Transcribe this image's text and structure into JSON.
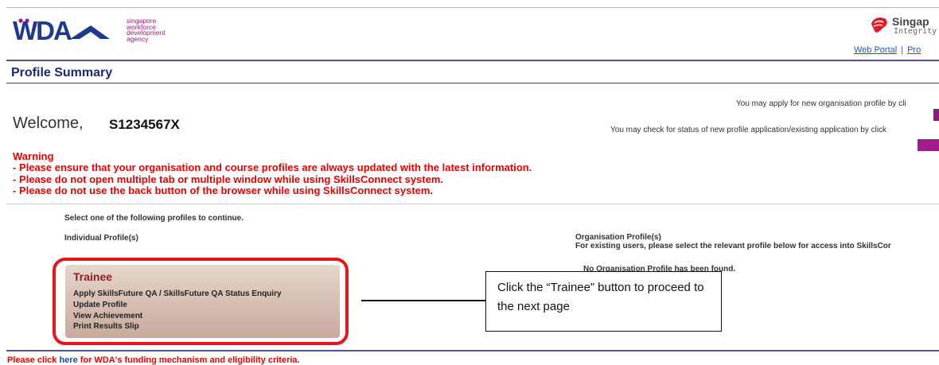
{
  "header": {
    "logo_lines": [
      "singapore",
      "workforce",
      "development",
      "agency"
    ],
    "right_brand_name": "Singap",
    "right_brand_sub": "Integrity",
    "links": [
      "Web Portal",
      "Pro"
    ]
  },
  "page": {
    "title": "Profile Summary",
    "welcome_label": "Welcome,",
    "welcome_user": "S1234567X",
    "right_note_1": "You may apply for new organisation profile by cli",
    "right_note_2": "You may check for status of new profile application/existing application by click",
    "warning": {
      "heading": "Warning",
      "lines": [
        "- Please ensure that your organisation and course profiles are always updated with the latest information.",
        "- Please do not open multiple tab or multiple window while using SkillsConnect system.",
        "- Please do not use the back button of the browser while using SkillsConnect system."
      ]
    },
    "select_prompt": "Select one of the following profiles to continue.",
    "individual_heading": "Individual Profile(s)",
    "org_heading": "Organisation Profile(s)",
    "org_sub": "For existing users, please select the relevant profile below for access into SkillsCor",
    "no_org": "No Organisation Profile has been found.",
    "trainee": {
      "title": "Trainee",
      "links": [
        "Apply SkillsFuture QA / SkillsFuture QA Status Enquiry",
        "Update Profile",
        "View Achievement",
        "Print Results Slip"
      ]
    },
    "callout": "Click the “Trainee” button to proceed to the next page",
    "footer": {
      "prefix": "Please click",
      "link": "here",
      "suffix": "for WDA's funding mechanism and eligibility criteria."
    }
  },
  "colors": {
    "wda_blue": "#1c3a8f",
    "wda_magenta": "#a0197a",
    "warning_red": "#e00000",
    "accent_purple": "#5a4f9a"
  }
}
